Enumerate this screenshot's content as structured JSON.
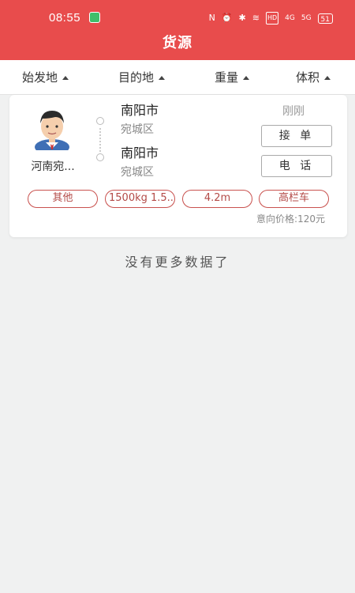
{
  "status_bar": {
    "time": "08:55",
    "icons": [
      "nfc-icon",
      "alarm-icon",
      "bluetooth-icon",
      "wifi-icon",
      "hd-icon",
      "signal-icon",
      "signal-icon",
      "battery-icon"
    ],
    "hd_label": "HD",
    "signal1_label": "4G",
    "signal2_label": "5G",
    "battery": "51"
  },
  "header": {
    "title": "货源"
  },
  "filters": [
    {
      "label": "始发地"
    },
    {
      "label": "目的地"
    },
    {
      "label": "重量"
    },
    {
      "label": "体积"
    }
  ],
  "listing": {
    "shipper_name": "河南宛...",
    "origin_city": "南阳市",
    "origin_district": "宛城区",
    "dest_city": "南阳市",
    "dest_district": "宛城区",
    "posted": "刚刚",
    "accept_label": "接 单",
    "call_label": "电 话",
    "tags": [
      "其他",
      "1500kg 1.5...",
      "4.2m",
      "高栏车"
    ],
    "price": "意向价格:120元"
  },
  "footer": {
    "no_more": "没有更多数据了"
  },
  "colors": {
    "primary": "#e84c4c",
    "tag_border": "#c9524f",
    "background": "#f0f1f1"
  }
}
